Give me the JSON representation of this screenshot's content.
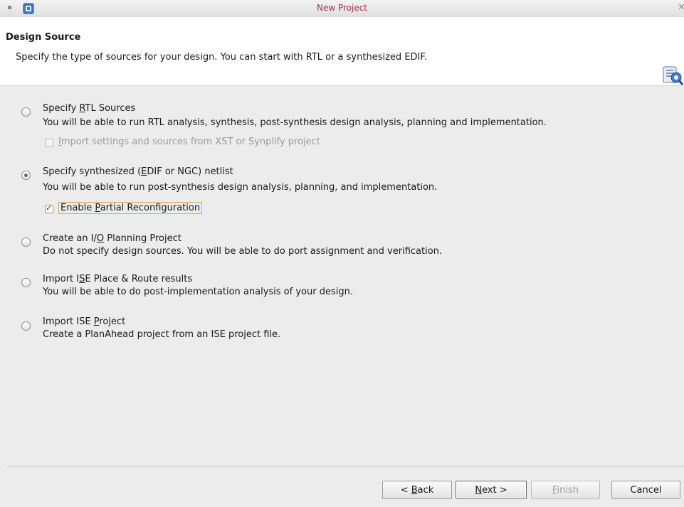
{
  "window": {
    "title": "New Project"
  },
  "header": {
    "title": "Design Source",
    "description": "Specify the type of sources for your design. You can start with RTL or a synthesized EDIF."
  },
  "options": [
    {
      "title_pre": "Specify ",
      "title_mnemonic": "R",
      "title_post": "TL Sources",
      "description": "You will be able to run RTL analysis, synthesis, post-synthesis design analysis, planning and implementation.",
      "selected": false
    },
    {
      "title_pre": "Specify synthesized (",
      "title_mnemonic": "E",
      "title_post": "DIF or NGC) netlist",
      "description": "You will be able to run post-synthesis design analysis, planning, and implementation.",
      "selected": true
    },
    {
      "title_pre": "Create an I/",
      "title_mnemonic": "O",
      "title_post": " Planning Project",
      "description": "Do not specify design sources. You will be able to do port assignment and verification.",
      "selected": false
    },
    {
      "title_pre": "Import I",
      "title_mnemonic": "S",
      "title_post": "E Place & Route results",
      "description": "You will be able to do post-implementation analysis of your design.",
      "selected": false
    },
    {
      "title_pre": "Import ISE ",
      "title_mnemonic": "P",
      "title_post": "roject",
      "description": "Create a PlanAhead project from an ISE project file.",
      "selected": false
    }
  ],
  "import_settings": {
    "mnemonic": "I",
    "label_post": "mport settings and sources from XST or Synplify project",
    "checked": false,
    "enabled": false
  },
  "partial_reconfig": {
    "label_pre": "Enable ",
    "mnemonic": "P",
    "label_post": "artial Reconfiguration",
    "checked": true,
    "enabled": true
  },
  "buttons": {
    "back": {
      "pre": "< ",
      "mnemonic": "B",
      "post": "ack"
    },
    "next": {
      "mnemonic": "N",
      "post": "ext >"
    },
    "finish": {
      "mnemonic": "F",
      "post": "inish"
    },
    "cancel": {
      "label": "Cancel"
    }
  },
  "colors": {
    "title_text": "#a83246",
    "window_bg": "#ececec",
    "header_bg": "#ffffff"
  }
}
